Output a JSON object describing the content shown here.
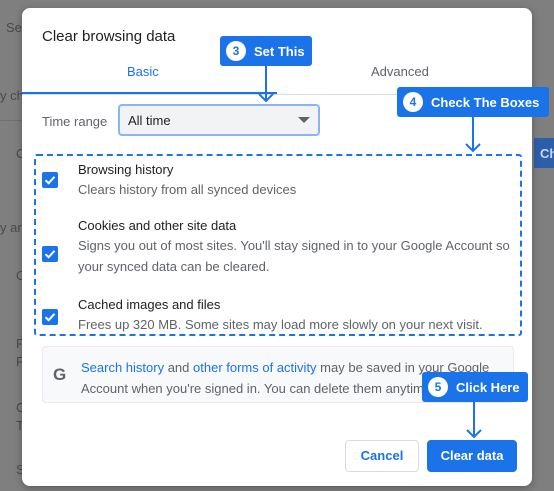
{
  "background": {
    "texts": [
      "Se",
      "y ch",
      "C",
      "y ar",
      "C",
      "F",
      "F",
      "C",
      "T",
      "S",
      "Ch"
    ]
  },
  "dialog": {
    "title": "Clear browsing data",
    "tabs": [
      {
        "label": "Basic",
        "selected": true
      },
      {
        "label": "Advanced",
        "selected": false
      }
    ],
    "time_range": {
      "label": "Time range",
      "value": "All time"
    },
    "items": [
      {
        "title": "Browsing history",
        "description": "Clears history from all synced devices",
        "checked": true
      },
      {
        "title": "Cookies and other site data",
        "description": "Signs you out of most sites. You'll stay signed in to your Google Account so your synced data can be cleared.",
        "checked": true
      },
      {
        "title": "Cached images and files",
        "description": "Frees up 320 MB. Some sites may load more slowly on your next visit.",
        "checked": true
      }
    ],
    "info": {
      "icon": "google-g-icon",
      "link1": "Search history",
      "text1": " and ",
      "link2": "other forms of activity",
      "text2": " may be saved in your Google Account when you're signed in. You can delete them anytime."
    },
    "buttons": {
      "cancel": "Cancel",
      "clear": "Clear data"
    }
  },
  "callouts": [
    {
      "number": "3",
      "label": "Set This"
    },
    {
      "number": "4",
      "label": "Check The Boxes"
    },
    {
      "number": "5",
      "label": "Click Here"
    }
  ],
  "colors": {
    "accent": "#1a73e8",
    "text_primary": "#202124",
    "text_secondary": "#5f6368"
  }
}
